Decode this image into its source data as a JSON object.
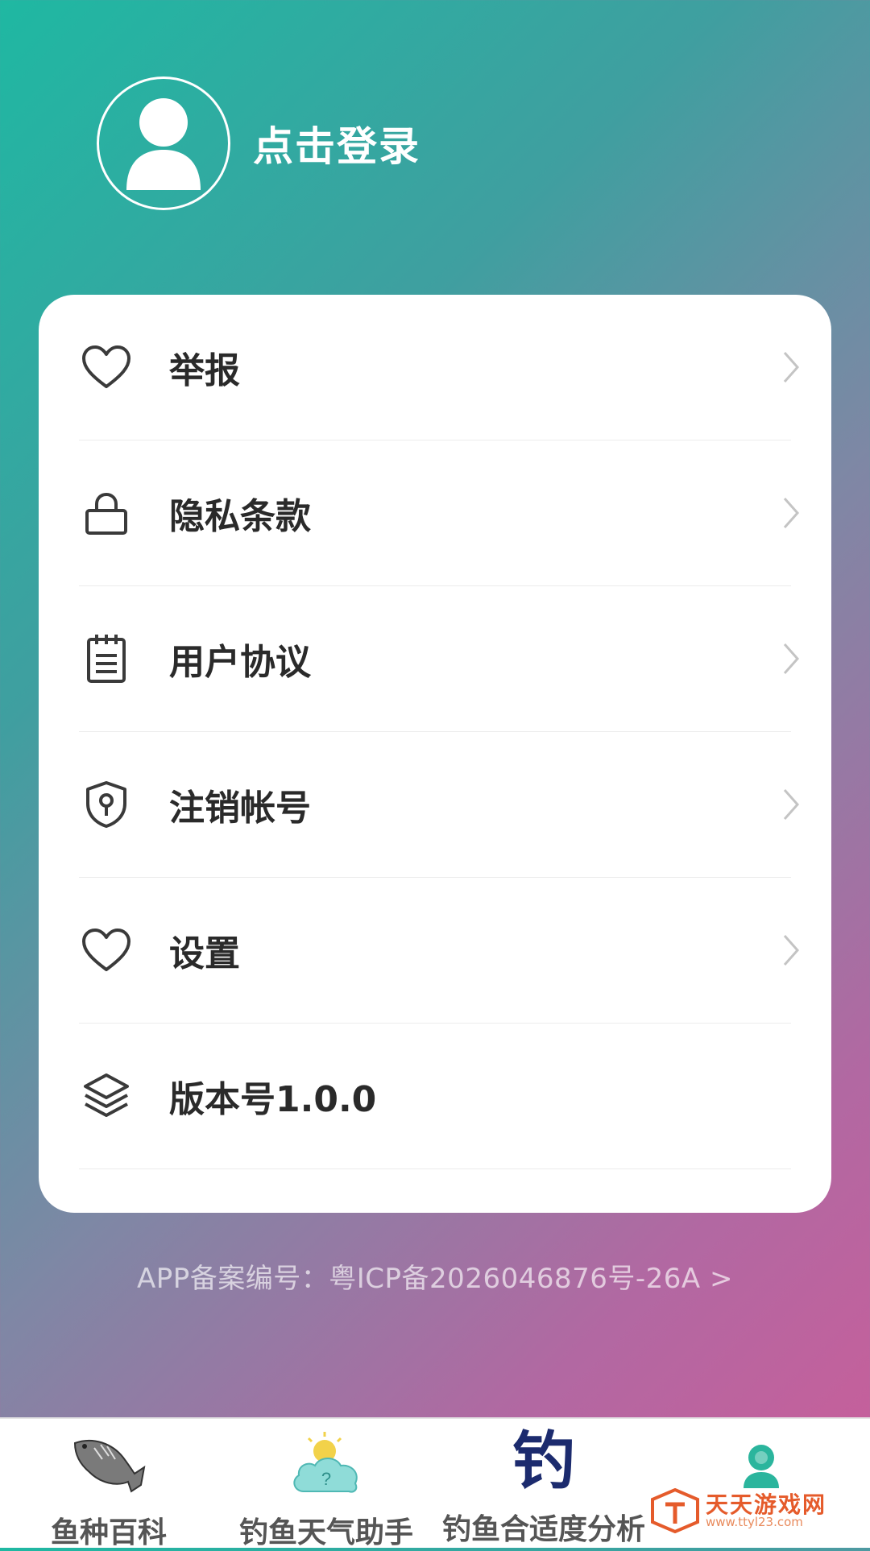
{
  "profile": {
    "login_label": "点击登录"
  },
  "menu": [
    {
      "label": "举报",
      "icon": "heart-icon",
      "has_arrow": true
    },
    {
      "label": "隐私条款",
      "icon": "lock-icon",
      "has_arrow": true
    },
    {
      "label": "用户协议",
      "icon": "document-icon",
      "has_arrow": true
    },
    {
      "label": "注销帐号",
      "icon": "shield-icon",
      "has_arrow": true
    },
    {
      "label": "设置",
      "icon": "heart-icon",
      "has_arrow": true
    },
    {
      "label": "版本号1.0.0",
      "icon": "layers-icon",
      "has_arrow": false
    }
  ],
  "icp": {
    "text": "APP备案编号：粤ICP备2026046876号-26A >"
  },
  "tabbar": [
    {
      "label": "鱼种百科",
      "icon": "fish-icon"
    },
    {
      "label": "钓鱼天气助手",
      "icon": "weather-cloud-icon"
    },
    {
      "label": "钓鱼合适度分析",
      "icon": "diao-character-icon",
      "icon_text": "钓"
    },
    {
      "label": "",
      "icon": "profile-icon"
    }
  ],
  "watermark": {
    "title": "天天游戏网",
    "url": "www.ttyl23.com"
  },
  "colors": {
    "accent_teal": "#1fb8a2",
    "accent_pink": "#cb5d99",
    "text_dark": "#2a2a2a",
    "tab_teal": "#2bb59d",
    "diao_blue": "#1c2b6e"
  }
}
